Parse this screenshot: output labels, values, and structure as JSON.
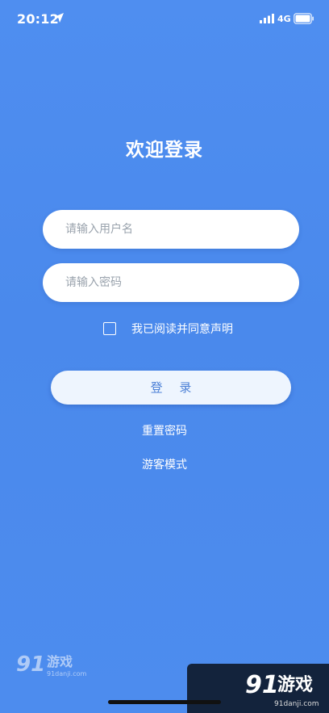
{
  "status_bar": {
    "time": "20:12",
    "network": "4G"
  },
  "login": {
    "title": "欢迎登录",
    "username_placeholder": "请输入用户名",
    "password_placeholder": "请输入密码",
    "agreement_label": "我已阅读并同意声明",
    "login_button": "登 录",
    "reset_password": "重置密码",
    "guest_mode": "游客模式"
  },
  "watermark": {
    "logo_text": "91游戏",
    "site_text": "91danji.com"
  },
  "colors": {
    "background": "#4b8aed",
    "button_text": "#4a7fd6",
    "button_bg": "#eef5fe"
  }
}
